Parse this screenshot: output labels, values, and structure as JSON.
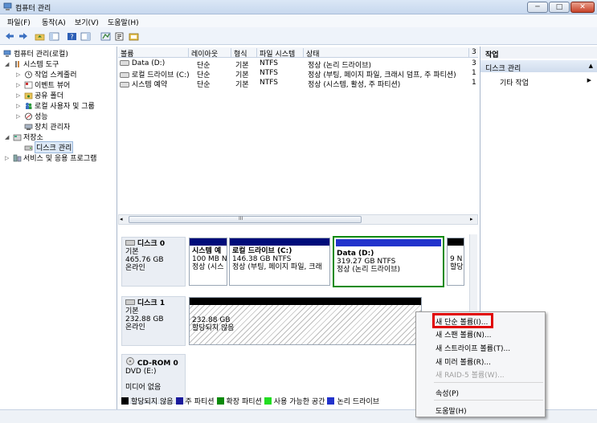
{
  "window": {
    "title": "컴퓨터 관리"
  },
  "menu": [
    "파일(F)",
    "동작(A)",
    "보기(V)",
    "도움말(H)"
  ],
  "tree": [
    {
      "label": "컴퓨터 관리(로컬)",
      "icon": "computer-icon"
    },
    {
      "label": "시스템 도구",
      "icon": "tools-icon"
    },
    {
      "label": "작업 스케줄러",
      "icon": "clock-icon"
    },
    {
      "label": "이벤트 뷰어",
      "icon": "event-log-icon"
    },
    {
      "label": "공유 폴더",
      "icon": "shared-folder-icon"
    },
    {
      "label": "로컬 사용자 및 그룹",
      "icon": "users-icon"
    },
    {
      "label": "성능",
      "icon": "performance-icon"
    },
    {
      "label": "장치 관리자",
      "icon": "device-manager-icon"
    },
    {
      "label": "저장소",
      "icon": "storage-icon"
    },
    {
      "label": "디스크 관리",
      "icon": "disk-icon"
    },
    {
      "label": "서비스 및 응용 프로그램",
      "icon": "services-icon"
    }
  ],
  "volumes": {
    "headers": [
      "볼륨",
      "레이아웃",
      "형식",
      "파일 시스템",
      "상태",
      "3"
    ],
    "rows": [
      [
        "Data (D:)",
        "단순",
        "기본",
        "NTFS",
        "정상 (논리 드라이브)",
        "3"
      ],
      [
        "로컬 드라이브 (C:)",
        "단순",
        "기본",
        "NTFS",
        "정상 (부팅, 페이지 파일, 크래시 덤프, 주 파티션)",
        "1"
      ],
      [
        "시스템 예약",
        "단순",
        "기본",
        "NTFS",
        "정상 (시스템, 활성, 주 파티션)",
        "1"
      ]
    ],
    "scroll_mark": "III"
  },
  "disks": {
    "disk0": {
      "name": "디스크 0",
      "type": "기본",
      "size": "465.76 GB",
      "state": "온라인",
      "partitions": [
        {
          "name": "시스템 예",
          "size": "100 MB N",
          "status": "정상 (시스"
        },
        {
          "name": "로컬 드라이브  (C:)",
          "size": "146.38 GB NTFS",
          "status": "정상 (부팅, 페이지 파일, 크래"
        },
        {
          "name": "Data  (D:)",
          "size": "319.27 GB NTFS",
          "status": "정상 (논리 드라이브)"
        },
        {
          "name": "",
          "size": "9 N",
          "status": "할당"
        }
      ]
    },
    "disk1": {
      "name": "디스크 1",
      "type": "기본",
      "size": "232.88 GB",
      "state": "온라인",
      "unalloc_size": "232.88 GB",
      "unalloc_label": "할당되지 않음"
    },
    "cdrom": {
      "name": "CD-ROM 0",
      "drive": "DVD (E:)",
      "media": "미디어 없음"
    }
  },
  "legend": [
    {
      "label": "할당되지 않음",
      "color": "#000000"
    },
    {
      "label": "주 파티션",
      "color": "#1a1a9c"
    },
    {
      "label": "확장 파티션",
      "color": "#0a8a0a"
    },
    {
      "label": "사용 가능한 공간",
      "color": "#22dd22"
    },
    {
      "label": "논리 드라이브",
      "color": "#2233cc"
    }
  ],
  "actions": {
    "header": "작업",
    "section": "디스크 관리",
    "item": "기타 작업"
  },
  "context_menu": [
    {
      "label": "새 단순 볼륨(I)...",
      "enabled": true
    },
    {
      "label": "새 스팬 볼륨(N)...",
      "enabled": true
    },
    {
      "label": "새 스트라이프 볼륨(T)...",
      "enabled": true
    },
    {
      "label": "새 미러 볼륨(R)...",
      "enabled": true
    },
    {
      "label": "새 RAID-5 볼륨(W)...",
      "enabled": false
    },
    {
      "label": "속성(P)",
      "enabled": true
    },
    {
      "label": "도움말(H)",
      "enabled": true
    }
  ]
}
